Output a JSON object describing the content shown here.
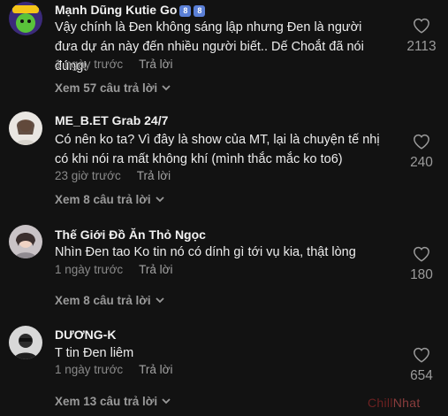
{
  "comments": [
    {
      "username": "Mạnh Dũng Kutie Go",
      "badges": [
        "8",
        "8"
      ],
      "text": "Vậy chính là Đen không sáng lập nhưng Đen là người đưa dự án này đến nhiều người biết.. Dế Choắt đã nói đúng!",
      "time": "1 ngày trước",
      "reply_label": "Trả lời",
      "view_replies": "Xem 57 câu trả lời",
      "likes": "2113"
    },
    {
      "username": "ME_B.ET Grab 24/7",
      "text": "Có nên ko ta? Vì đây là show của MT, lại là chuyện tế nhị có khi nói ra mất không khí (mình thắc mắc ko to6)",
      "time": "23 giờ trước",
      "reply_label": "Trả lời",
      "view_replies": "Xem 8 câu trả lời",
      "likes": "240"
    },
    {
      "username": "Thế Giới Đồ Ăn Thỏ Ngọc",
      "text": "Nhìn Đen tao Ko tin nó có dính gì tới vụ kia, thật lòng",
      "time": "1 ngày trước",
      "reply_label": "Trả lời",
      "view_replies": "Xem 8 câu trả lời",
      "likes": "180"
    },
    {
      "username": "DƯƠNG-K",
      "text": "T tin Đen liêm",
      "time": "1 ngày trước",
      "reply_label": "Trả lời",
      "view_replies": "Xem 13 câu trả lời",
      "likes": "654"
    }
  ],
  "icons": {
    "like": "heart-outline-icon",
    "expand": "chevron-down-icon"
  },
  "watermark": {
    "part1": "Chill",
    "part2": "Nhat"
  },
  "colors": {
    "background": "#121212",
    "watermark": "#6b2121"
  }
}
